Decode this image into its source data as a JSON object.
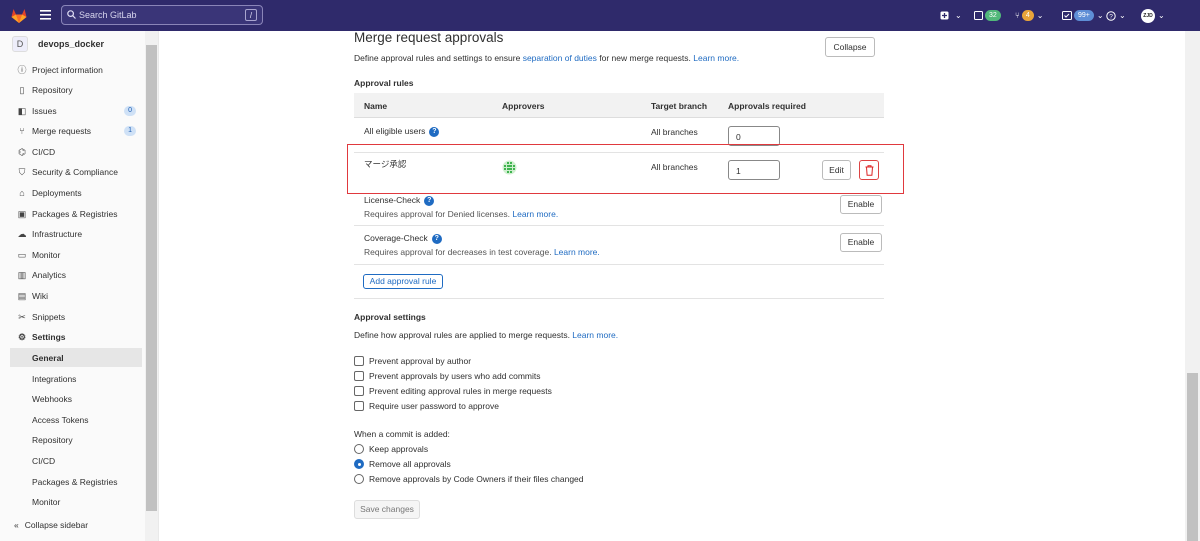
{
  "topbar": {
    "search_placeholder": "Search GitLab",
    "search_shortcut": "/",
    "issues_count": "32",
    "mr_count": "4",
    "todos_count": "99+",
    "avatar_text": "ZJD"
  },
  "sidebar": {
    "project_avatar": "D",
    "project_name": "devops_docker",
    "items": [
      {
        "label": "Project information",
        "icon": "info-icon"
      },
      {
        "label": "Repository",
        "icon": "doc-icon"
      },
      {
        "label": "Issues",
        "icon": "issues-icon",
        "badge": "0"
      },
      {
        "label": "Merge requests",
        "icon": "merge-icon",
        "badge": "1"
      },
      {
        "label": "CI/CD",
        "icon": "rocket-icon"
      },
      {
        "label": "Security & Compliance",
        "icon": "shield-icon"
      },
      {
        "label": "Deployments",
        "icon": "deploy-icon"
      },
      {
        "label": "Packages & Registries",
        "icon": "package-icon"
      },
      {
        "label": "Infrastructure",
        "icon": "cloud-icon"
      },
      {
        "label": "Monitor",
        "icon": "monitor-icon"
      },
      {
        "label": "Analytics",
        "icon": "chart-icon"
      },
      {
        "label": "Wiki",
        "icon": "book-icon"
      },
      {
        "label": "Snippets",
        "icon": "scissors-icon"
      },
      {
        "label": "Settings",
        "icon": "gear-icon"
      }
    ],
    "sub_items": [
      "General",
      "Integrations",
      "Webhooks",
      "Access Tokens",
      "Repository",
      "CI/CD",
      "Packages & Registries",
      "Monitor"
    ],
    "collapse_label": "Collapse sidebar"
  },
  "main": {
    "title": "Merge request approvals",
    "desc_prefix": "Define approval rules and settings to ensure ",
    "desc_link1": "separation of duties",
    "desc_mid": " for new merge requests. ",
    "desc_link2": "Learn more.",
    "collapse_button": "Collapse",
    "rules_heading": "Approval rules",
    "columns": [
      "Name",
      "Approvers",
      "Target branch",
      "Approvals required"
    ],
    "rows": [
      {
        "name": "All eligible users",
        "branch": "All branches",
        "required": "0"
      },
      {
        "name": "マージ承認",
        "branch": "All branches",
        "required": "1",
        "edit": "Edit"
      }
    ],
    "license_check": {
      "name": "License-Check",
      "desc": "Requires approval for Denied licenses. ",
      "link": "Learn more.",
      "button": "Enable"
    },
    "coverage_check": {
      "name": "Coverage-Check",
      "desc": "Requires approval for decreases in test coverage. ",
      "link": "Learn more.",
      "button": "Enable"
    },
    "add_rule": "Add approval rule",
    "settings_heading": "Approval settings",
    "settings_desc": "Define how approval rules are applied to merge requests. ",
    "settings_link": "Learn more.",
    "checkboxes": [
      "Prevent approval by author",
      "Prevent approvals by users who add commits",
      "Prevent editing approval rules in merge requests",
      "Require user password to approve"
    ],
    "commit_heading": "When a commit is added:",
    "radios": [
      {
        "label": "Keep approvals",
        "checked": false
      },
      {
        "label": "Remove all approvals",
        "checked": true
      },
      {
        "label": "Remove approvals by Code Owners if their files changed",
        "checked": false
      }
    ],
    "save_button": "Save changes"
  }
}
